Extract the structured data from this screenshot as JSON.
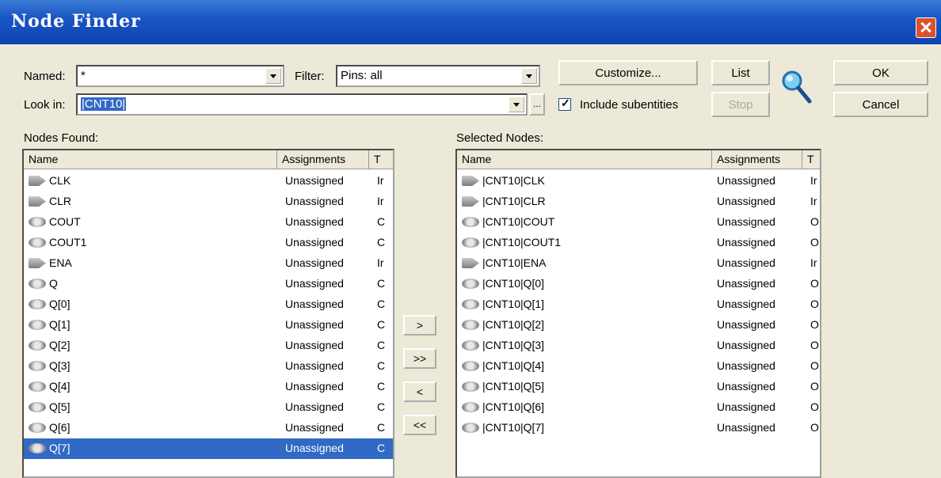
{
  "window": {
    "title": "Node Finder"
  },
  "labels": {
    "named": "Named:",
    "filter": "Filter:",
    "look_in": "Look in:",
    "nodes_found": "Nodes Found:",
    "selected_nodes": "Selected Nodes:",
    "include_subentities": "Include subentities"
  },
  "inputs": {
    "named_value": "*",
    "filter_value": "Pins: all",
    "look_in_value": "|CNT10|"
  },
  "buttons": {
    "customize": "Customize...",
    "list": "List",
    "stop": "Stop",
    "ok": "OK",
    "cancel": "Cancel",
    "browse": "...",
    "add_one": ">",
    "add_all": ">>",
    "remove_one": "<",
    "remove_all": "<<"
  },
  "columns": {
    "name": "Name",
    "assignments": "Assignments",
    "type": "T"
  },
  "nodes_found": [
    {
      "name": "CLK",
      "assign": "Unassigned",
      "type": "Ir",
      "icon": "input-pin-icon"
    },
    {
      "name": "CLR",
      "assign": "Unassigned",
      "type": "Ir",
      "icon": "input-pin-icon"
    },
    {
      "name": "COUT",
      "assign": "Unassigned",
      "type": "C",
      "icon": "output-pin-icon"
    },
    {
      "name": "COUT1",
      "assign": "Unassigned",
      "type": "C",
      "icon": "output-pin-icon"
    },
    {
      "name": "ENA",
      "assign": "Unassigned",
      "type": "Ir",
      "icon": "input-pin-icon"
    },
    {
      "name": "Q",
      "assign": "Unassigned",
      "type": "C",
      "icon": "bus-pin-icon"
    },
    {
      "name": "Q[0]",
      "assign": "Unassigned",
      "type": "C",
      "icon": "output-pin-icon"
    },
    {
      "name": "Q[1]",
      "assign": "Unassigned",
      "type": "C",
      "icon": "output-pin-icon"
    },
    {
      "name": "Q[2]",
      "assign": "Unassigned",
      "type": "C",
      "icon": "output-pin-icon"
    },
    {
      "name": "Q[3]",
      "assign": "Unassigned",
      "type": "C",
      "icon": "output-pin-icon"
    },
    {
      "name": "Q[4]",
      "assign": "Unassigned",
      "type": "C",
      "icon": "output-pin-icon"
    },
    {
      "name": "Q[5]",
      "assign": "Unassigned",
      "type": "C",
      "icon": "output-pin-icon"
    },
    {
      "name": "Q[6]",
      "assign": "Unassigned",
      "type": "C",
      "icon": "output-pin-icon"
    },
    {
      "name": "Q[7]",
      "assign": "Unassigned",
      "type": "C",
      "icon": "output-pin-icon",
      "selected": true
    }
  ],
  "selected_nodes": [
    {
      "name": "|CNT10|CLK",
      "assign": "Unassigned",
      "type": "Ir",
      "icon": "input-pin-icon"
    },
    {
      "name": "|CNT10|CLR",
      "assign": "Unassigned",
      "type": "Ir",
      "icon": "input-pin-icon"
    },
    {
      "name": "|CNT10|COUT",
      "assign": "Unassigned",
      "type": "O",
      "icon": "output-pin-icon"
    },
    {
      "name": "|CNT10|COUT1",
      "assign": "Unassigned",
      "type": "O",
      "icon": "output-pin-icon"
    },
    {
      "name": "|CNT10|ENA",
      "assign": "Unassigned",
      "type": "Ir",
      "icon": "input-pin-icon"
    },
    {
      "name": "|CNT10|Q[0]",
      "assign": "Unassigned",
      "type": "O",
      "icon": "output-pin-icon"
    },
    {
      "name": "|CNT10|Q[1]",
      "assign": "Unassigned",
      "type": "O",
      "icon": "output-pin-icon"
    },
    {
      "name": "|CNT10|Q[2]",
      "assign": "Unassigned",
      "type": "O",
      "icon": "output-pin-icon"
    },
    {
      "name": "|CNT10|Q[3]",
      "assign": "Unassigned",
      "type": "O",
      "icon": "output-pin-icon"
    },
    {
      "name": "|CNT10|Q[4]",
      "assign": "Unassigned",
      "type": "O",
      "icon": "output-pin-icon"
    },
    {
      "name": "|CNT10|Q[5]",
      "assign": "Unassigned",
      "type": "O",
      "icon": "output-pin-icon"
    },
    {
      "name": "|CNT10|Q[6]",
      "assign": "Unassigned",
      "type": "O",
      "icon": "output-pin-icon"
    },
    {
      "name": "|CNT10|Q[7]",
      "assign": "Unassigned",
      "type": "O",
      "icon": "output-pin-icon"
    }
  ],
  "colors": {
    "selection": "#316ac5",
    "titlebar": "#1a56c4",
    "close": "#d9532f"
  }
}
